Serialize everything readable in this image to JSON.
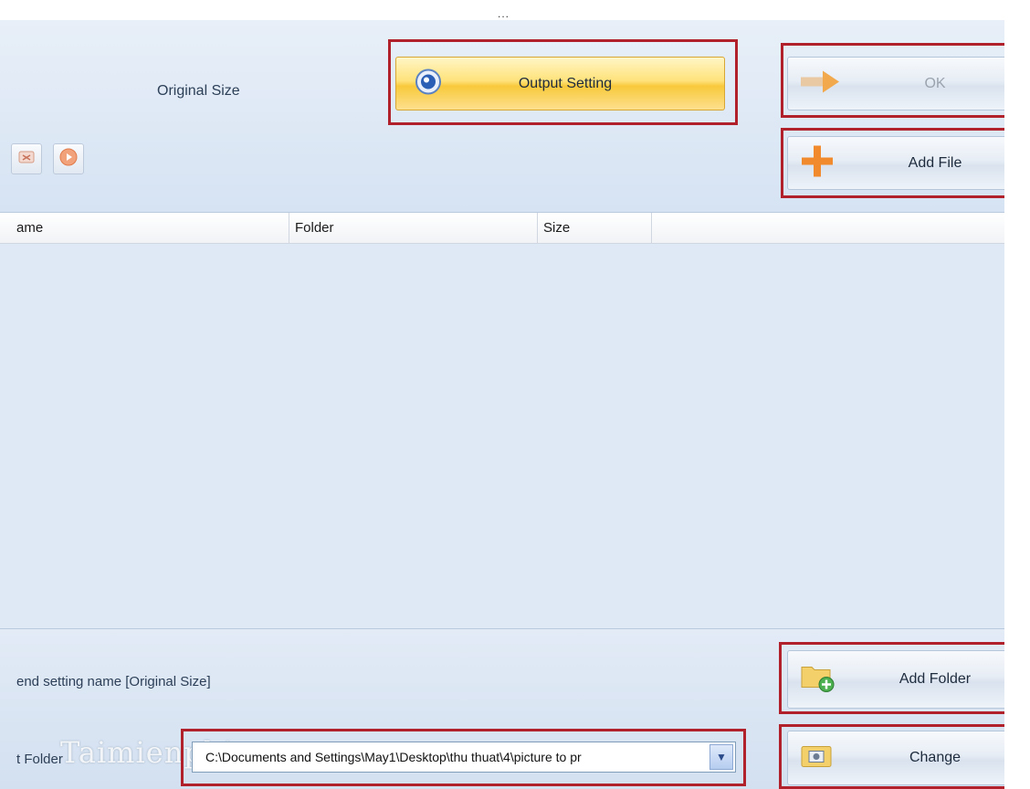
{
  "window": {
    "title_fragment": "..."
  },
  "header": {
    "size_label": "Original Size",
    "output_setting_button": "Output Setting",
    "ok_button": "OK",
    "add_file_button": "Add File"
  },
  "file_list": {
    "columns": [
      "ame",
      "Folder",
      "Size",
      ""
    ],
    "rows": []
  },
  "footer": {
    "append_label": "end setting name [Original Size]",
    "output_folder_label": "t Folder",
    "output_folder_path": "C:\\Documents and Settings\\May1\\Desktop\\thu thuat\\4\\picture to pr",
    "add_folder_button": "Add Folder",
    "change_button": "Change"
  },
  "watermark": "Taimienphi.vn",
  "icons": {
    "output_setting": "gear-icon",
    "ok": "arrow-right-icon",
    "add_file": "plus-icon",
    "add_folder": "folder-add-icon",
    "change": "folder-camera-icon",
    "tool_1": "remove-icon",
    "tool_2": "play-icon",
    "dropdown": "chevron-down-icon"
  },
  "colors": {
    "highlight_box": "#b0212c",
    "output_button": "#f8c93b",
    "panel_bg": "#dfe9f5"
  }
}
